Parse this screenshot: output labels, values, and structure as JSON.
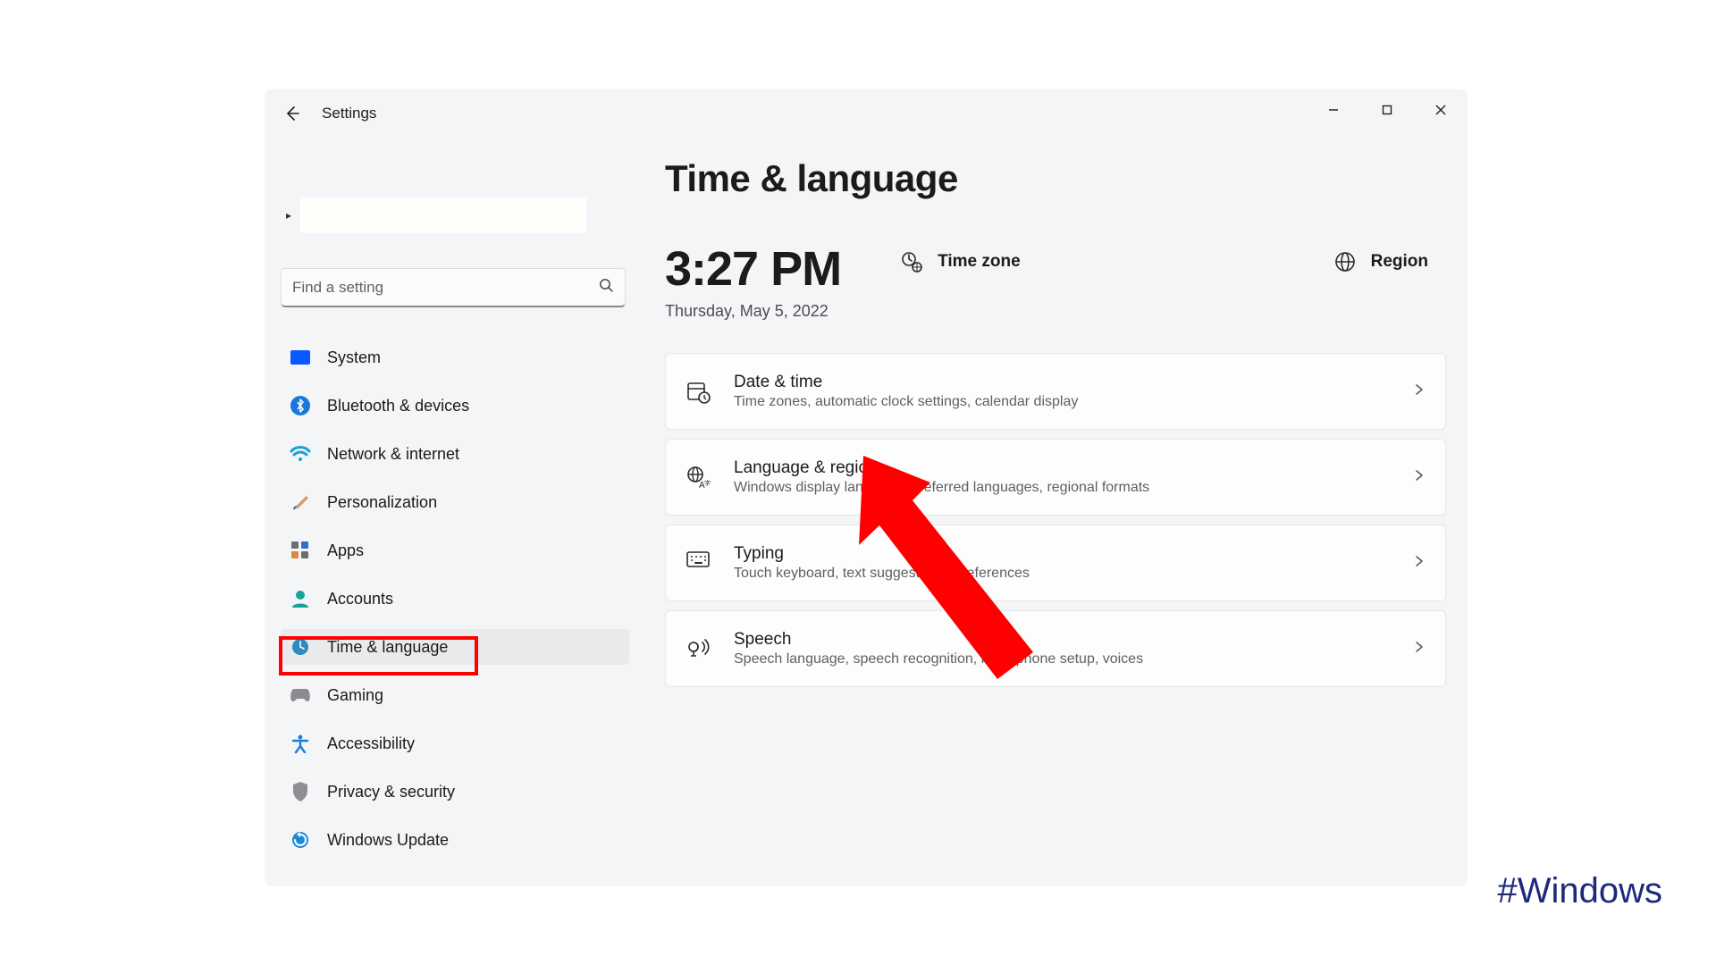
{
  "app_title": "Settings",
  "search": {
    "placeholder": "Find a setting"
  },
  "sidebar": {
    "items": [
      {
        "label": "System"
      },
      {
        "label": "Bluetooth & devices"
      },
      {
        "label": "Network & internet"
      },
      {
        "label": "Personalization"
      },
      {
        "label": "Apps"
      },
      {
        "label": "Accounts"
      },
      {
        "label": "Time & language"
      },
      {
        "label": "Gaming"
      },
      {
        "label": "Accessibility"
      },
      {
        "label": "Privacy & security"
      },
      {
        "label": "Windows Update"
      }
    ],
    "active_index": 6
  },
  "page": {
    "title": "Time & language",
    "clock": "3:27 PM",
    "date": "Thursday, May 5, 2022",
    "hero_links": {
      "timezone": "Time zone",
      "region": "Region"
    }
  },
  "cards": [
    {
      "title": "Date & time",
      "desc": "Time zones, automatic clock settings, calendar display"
    },
    {
      "title": "Language & region",
      "desc": "Windows display language, preferred languages, regional formats"
    },
    {
      "title": "Typing",
      "desc": "Touch keyboard, text suggestions, preferences"
    },
    {
      "title": "Speech",
      "desc": "Speech language, speech recognition, microphone setup, voices"
    }
  ],
  "annotation_hashtag": "#Windows"
}
